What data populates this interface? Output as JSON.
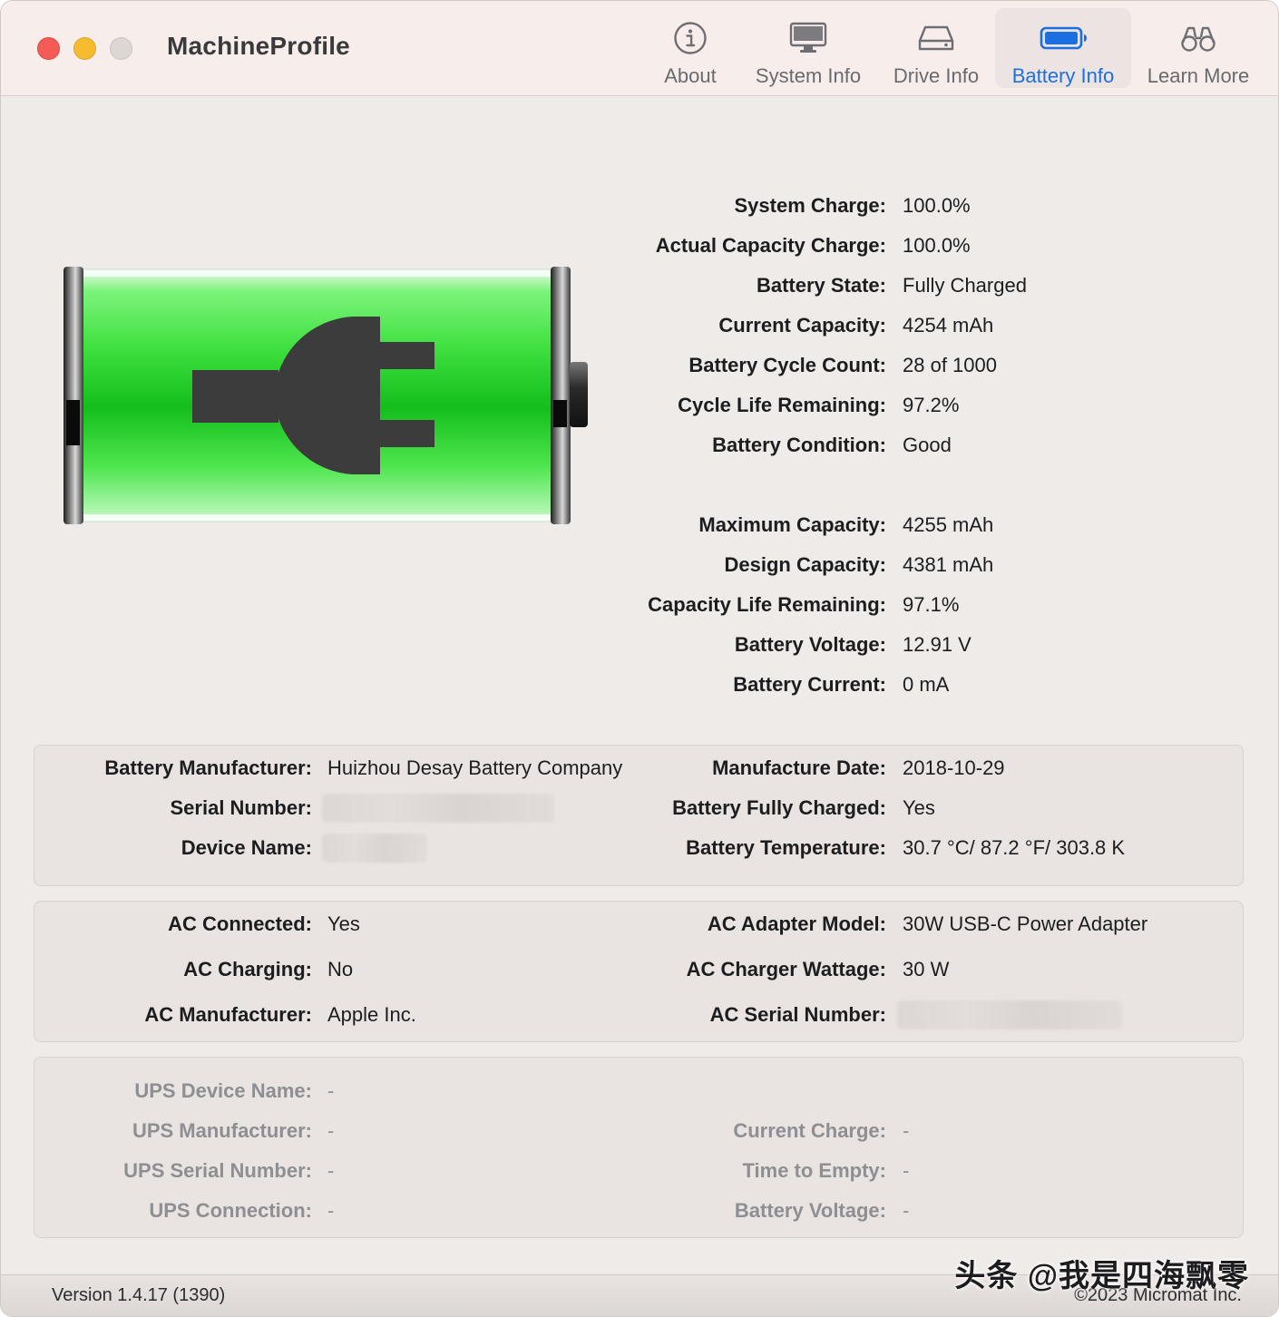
{
  "app": {
    "title": "MachineProfile"
  },
  "toolbar": [
    {
      "label": "About",
      "icon": "info-icon"
    },
    {
      "label": "System Info",
      "icon": "display-icon"
    },
    {
      "label": "Drive Info",
      "icon": "drive-icon"
    },
    {
      "label": "Battery Info",
      "icon": "battery-icon",
      "active": true
    },
    {
      "label": "Learn More",
      "icon": "binoculars-icon"
    }
  ],
  "colors": {
    "accent": "#1c6fe0",
    "battery_green": "#22c52a",
    "plug": "#3c3c3c"
  },
  "battery_status": {
    "charge_percent": 100,
    "plugged_in": true
  },
  "summary_group1": [
    {
      "label": "System Charge:",
      "value": "100.0%"
    },
    {
      "label": "Actual Capacity Charge:",
      "value": "100.0%"
    },
    {
      "label": "Battery State:",
      "value": "Fully Charged"
    },
    {
      "label": "Current Capacity:",
      "value": "4254 mAh"
    },
    {
      "label": "Battery Cycle Count:",
      "value": "28 of 1000"
    },
    {
      "label": "Cycle Life Remaining:",
      "value": "97.2%"
    },
    {
      "label": "Battery Condition:",
      "value": "Good"
    }
  ],
  "summary_group2": [
    {
      "label": "Maximum Capacity:",
      "value": "4255 mAh"
    },
    {
      "label": "Design Capacity:",
      "value": "4381 mAh"
    },
    {
      "label": "Capacity Life Remaining:",
      "value": "97.1%"
    },
    {
      "label": "Battery Voltage:",
      "value": "12.91 V"
    },
    {
      "label": "Battery Current:",
      "value": "0 mA"
    }
  ],
  "battery_panel": {
    "left": [
      {
        "label": "Battery Manufacturer:",
        "value": "Huizhou Desay Battery Company"
      },
      {
        "label": "Serial Number:",
        "value": ""
      },
      {
        "label": "Device Name:",
        "value": ""
      }
    ],
    "right": [
      {
        "label": "Manufacture Date:",
        "value": "2018-10-29"
      },
      {
        "label": "Battery Fully Charged:",
        "value": "Yes"
      },
      {
        "label": "Battery Temperature:",
        "value": "30.7 °C/ 87.2 °F/ 303.8 K"
      }
    ]
  },
  "ac_panel": {
    "left": [
      {
        "label": "AC Connected:",
        "value": "Yes"
      },
      {
        "label": "AC Charging:",
        "value": "No"
      },
      {
        "label": "AC Manufacturer:",
        "value": "Apple Inc."
      }
    ],
    "right": [
      {
        "label": "AC Adapter Model:",
        "value": "30W USB-C Power Adapter"
      },
      {
        "label": "AC Charger Wattage:",
        "value": "30 W"
      },
      {
        "label": "AC Serial Number:",
        "value": ""
      }
    ]
  },
  "ups_panel": {
    "left": [
      {
        "label": "UPS Device Name:",
        "value": "-"
      },
      {
        "label": "UPS Manufacturer:",
        "value": "-"
      },
      {
        "label": "UPS Serial Number:",
        "value": "-"
      },
      {
        "label": "UPS Connection:",
        "value": "-"
      }
    ],
    "right": [
      {
        "label": "Current Charge:",
        "value": "-"
      },
      {
        "label": "Time to Empty:",
        "value": "-"
      },
      {
        "label": "Battery Voltage:",
        "value": "-"
      }
    ]
  },
  "footer": {
    "version": "Version 1.4.17 (1390)",
    "copyright": "©2023 Micromat Inc.",
    "watermark": "头条 @我是四海飘零"
  }
}
